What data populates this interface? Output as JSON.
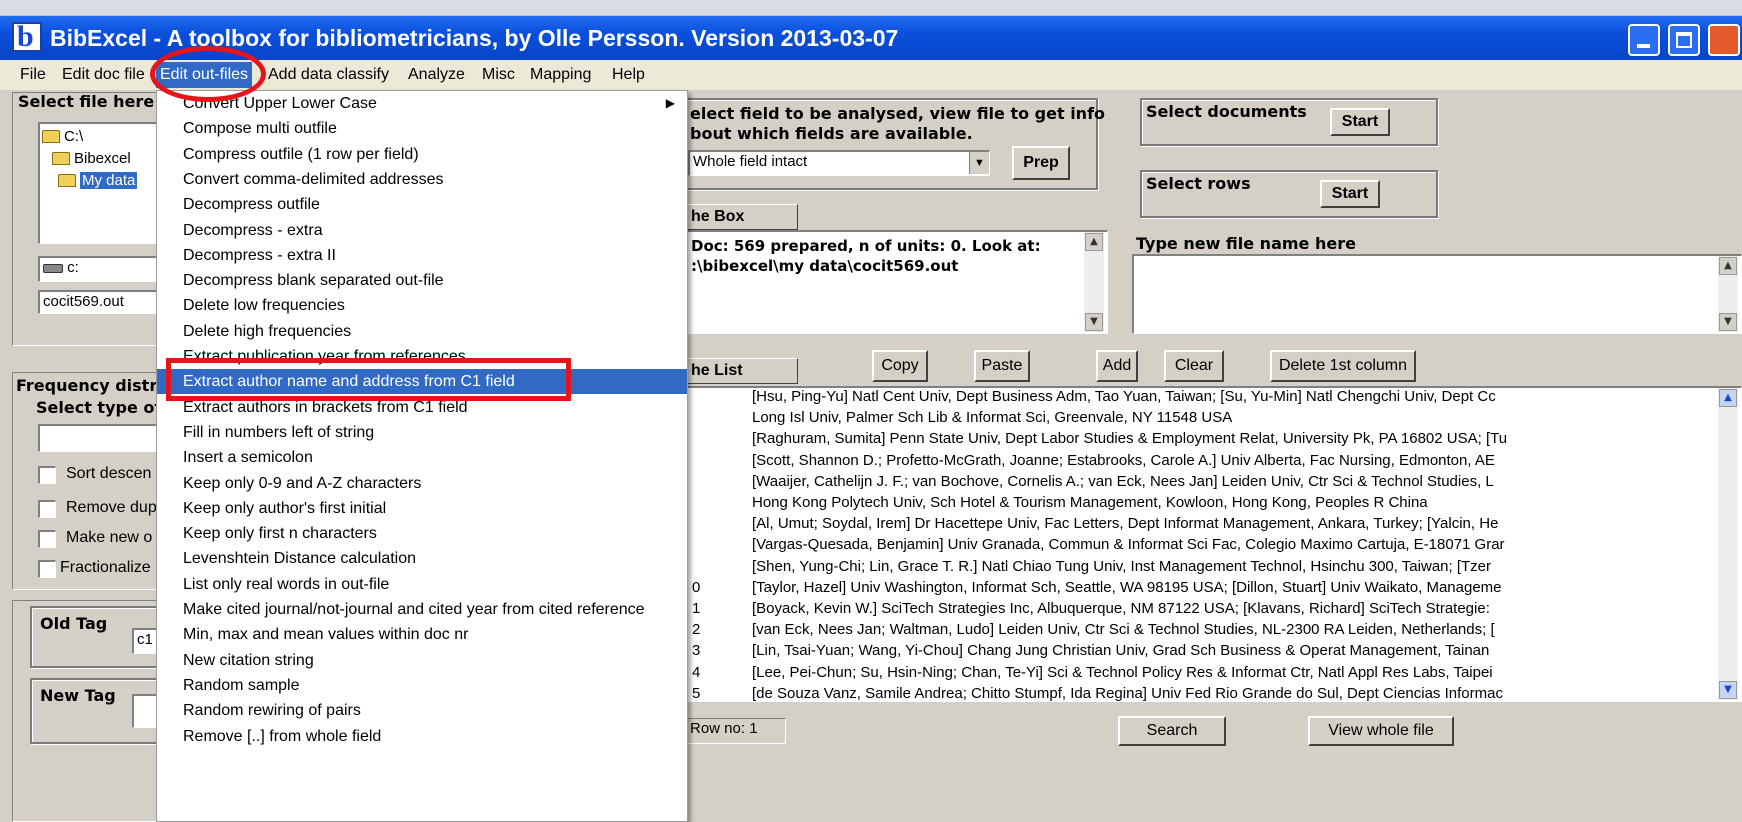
{
  "window": {
    "title": "BibExcel - A toolbox for bibliometricians, by Olle Persson. Version 2013-03-07",
    "icon_letter": "b"
  },
  "menubar": [
    "File",
    "Edit doc file",
    "Edit out-files",
    "Add data classify",
    "Analyze",
    "Misc",
    "Mapping",
    "Help"
  ],
  "left_panel": {
    "select_file_label": "Select file here",
    "tree": [
      "C:\\",
      "Bibexcel",
      "My data"
    ],
    "drive": "c:",
    "file_name": "cocit569.out",
    "freq_label": "Frequency distrib",
    "select_type_label": "Select type of",
    "checkboxes": [
      "Sort descen",
      "Remove dup",
      "Make new o",
      "Fractionalize"
    ],
    "old_tag_label": "Old Tag",
    "old_tag_value": "c1",
    "new_tag_label": "New Tag"
  },
  "field_group": {
    "line1": "elect field to be analysed, view file to get info",
    "line2": "bout which fields are available.",
    "dropdown_value": "Whole field intact",
    "prep_button": "Prep"
  },
  "select_documents": {
    "label": "Select documents",
    "button": "Start"
  },
  "select_rows": {
    "label": "Select rows",
    "button": "Start"
  },
  "the_box": {
    "label": "he Box",
    "line1": "Doc: 569 prepared, n of units: 0. Look at:",
    "line2": ":\\bibexcel\\my data\\cocit569.out"
  },
  "new_file": {
    "label": "Type new file name here"
  },
  "list": {
    "label": "he List",
    "buttons": [
      "Copy",
      "Paste",
      "Add",
      "Clear",
      "Delete 1st column"
    ],
    "numbers": [
      "",
      "",
      "",
      "",
      "",
      "",
      "",
      "",
      "",
      "0",
      "1",
      "2",
      "3",
      "4",
      "5"
    ],
    "rows": [
      "[Hsu, Ping-Yu] Natl Cent Univ, Dept Business Adm, Tao Yuan, Taiwan; [Su, Yu-Min] Natl Chengchi Univ, Dept Cc",
      "Long Isl Univ, Palmer Sch Lib & Informat Sci, Greenvale, NY 11548 USA",
      "[Raghuram, Sumita] Penn State Univ, Dept Labor Studies & Employment Relat, University Pk, PA 16802 USA; [Tu",
      "[Scott, Shannon D.; Profetto-McGrath, Joanne; Estabrooks, Carole A.] Univ Alberta, Fac Nursing, Edmonton, AE",
      "[Waaijer, Cathelijn J. F.; van Bochove, Cornelis A.; van Eck, Nees Jan] Leiden Univ, Ctr Sci & Technol Studies, L",
      "Hong Kong Polytech Univ, Sch Hotel & Tourism Management, Kowloon, Hong Kong, Peoples R China",
      "[Al, Umut; Soydal, Irem] Dr Hacettepe Univ, Fac Letters, Dept Informat Management, Ankara, Turkey; [Yalcin, He",
      "[Vargas-Quesada, Benjamin] Univ Granada, Commun & Informat Sci Fac, Colegio Maximo Cartuja, E-18071 Grar",
      "[Shen, Yung-Chi; Lin, Grace T. R.] Natl Chiao Tung Univ, Inst Management Technol, Hsinchu 300, Taiwan; [Tzer",
      "[Taylor, Hazel] Univ Washington, Informat Sch, Seattle, WA 98195 USA; [Dillon, Stuart] Univ Waikato, Manageme",
      "[Boyack, Kevin W.] SciTech Strategies Inc, Albuquerque, NM 87122 USA; [Klavans, Richard] SciTech Strategie:",
      "[van Eck, Nees Jan; Waltman, Ludo] Leiden Univ, Ctr Sci & Technol Studies, NL-2300 RA Leiden, Netherlands; [",
      "[Lin, Tsai-Yuan; Wang, Yi-Chou] Chang Jung Christian Univ, Grad Sch Business & Operat Management, Tainan",
      "[Lee, Pei-Chun; Su, Hsin-Ning; Chan, Te-Yi] Sci & Technol Policy Res & Informat Ctr, Natl Appl Res Labs, Taipei",
      "[de Souza Vanz, Samile Andrea; Chitto Stumpf, Ida Regina] Univ Fed Rio Grande do Sul, Dept Ciencias Informac"
    ],
    "row_no": "Row no: 1",
    "search_button": "Search",
    "view_button": "View whole file"
  },
  "dropdown_menu": {
    "items": [
      "Convert Upper Lower Case",
      "Compose multi outfile",
      "Compress outfile (1 row per field)",
      "Convert comma-delimited addresses",
      "Decompress outfile",
      "Decompress - extra",
      "Decompress - extra II",
      "Decompress blank separated out-file",
      "Delete low frequencies",
      "Delete high frequencies",
      "Extract publication year from references",
      "Extract author name and address from C1 field",
      "Extract authors in brackets from C1 field",
      "Fill in numbers left of string",
      "Insert a semicolon",
      "Keep only 0-9 and A-Z characters",
      "Keep only author's first initial",
      "Keep only first n characters",
      "Levenshtein Distance calculation",
      "List only real words in out-file",
      "Make cited journal/not-journal and cited year from cited reference",
      "Min, max and mean values within  doc nr",
      "New citation string",
      "Random sample",
      "Random rewiring of pairs",
      "Remove [..] from whole field"
    ],
    "highlighted_index": 11,
    "submenu_index": 0
  },
  "colors": {
    "titlebar": "#0a4fdc",
    "highlight": "#316ac5",
    "annotation": "#e8141b",
    "face": "#d4d0c8"
  }
}
